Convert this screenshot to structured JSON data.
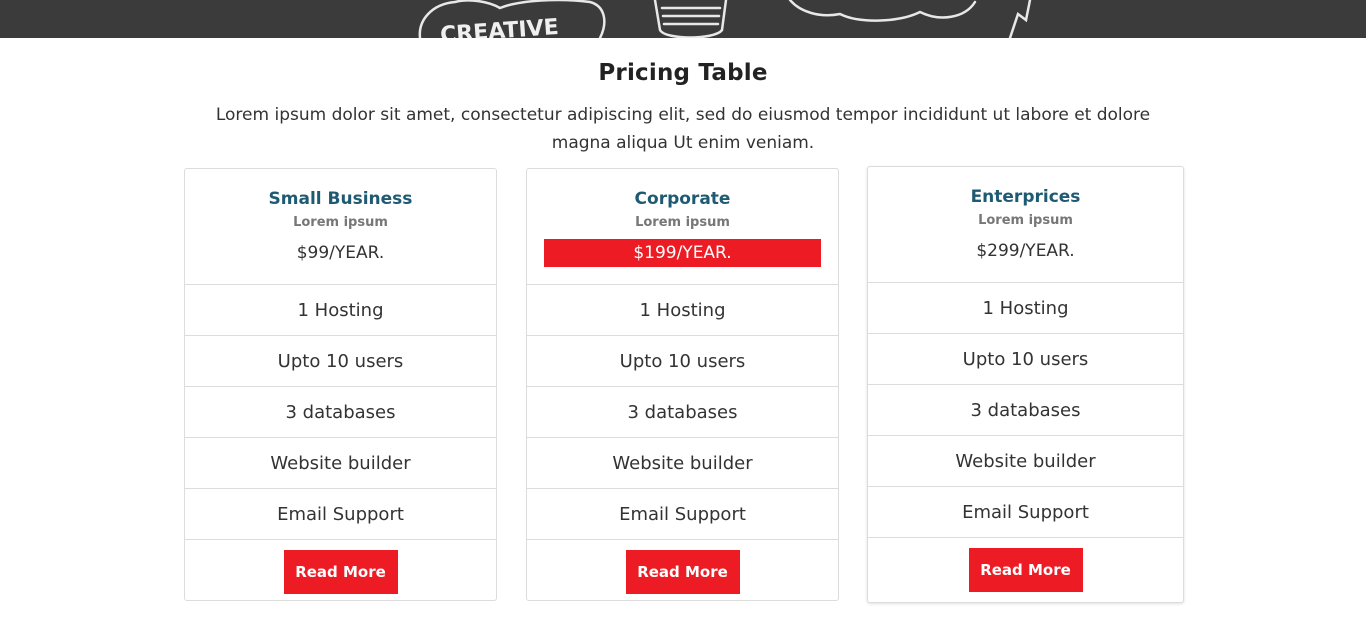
{
  "hero": {
    "image_icon": "chalkboard-doodle-image",
    "doodle_text": "CREATIVE"
  },
  "section": {
    "title": "Pricing Table",
    "subtitle": "Lorem ipsum dolor sit amet, consectetur adipiscing elit, sed do eiusmod tempor incididunt ut labore et dolore magna aliqua Ut enim veniam."
  },
  "colors": {
    "accent": "#ed1c24",
    "plan_name": "#1e5a72",
    "border": "#dcdcdc"
  },
  "plans": [
    {
      "name": "Small Business",
      "sub": "Lorem ipsum",
      "price": "$99/YEAR.",
      "highlighted": false,
      "features": [
        "1 Hosting",
        "Upto 10 users",
        "3 databases",
        "Website builder",
        "Email Support"
      ],
      "button": "Read More"
    },
    {
      "name": "Corporate",
      "sub": "Lorem ipsum",
      "price": "$199/YEAR.",
      "highlighted": true,
      "features": [
        "1 Hosting",
        "Upto 10 users",
        "3 databases",
        "Website builder",
        "Email Support"
      ],
      "button": "Read More"
    },
    {
      "name": "Enterprices",
      "sub": "Lorem ipsum",
      "price": "$299/YEAR.",
      "highlighted": false,
      "features": [
        "1 Hosting",
        "Upto 10 users",
        "3 databases",
        "Website builder",
        "Email Support"
      ],
      "button": "Read More"
    }
  ]
}
